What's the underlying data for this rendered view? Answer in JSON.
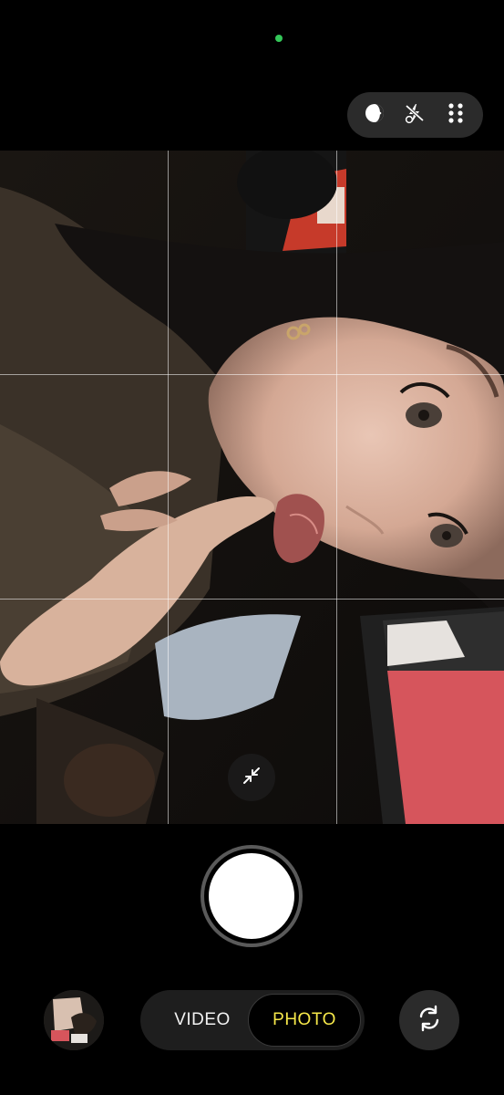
{
  "status": {
    "privacy_indicator_color": "#34c759"
  },
  "quick_settings": {
    "items": [
      {
        "icon": "filter-icon"
      },
      {
        "icon": "flash-off-icon"
      },
      {
        "icon": "more-options-icon"
      }
    ]
  },
  "viewfinder": {
    "grid_lines": "3x3",
    "overlay_button_icon": "collapse-arrows-icon"
  },
  "shutter": {
    "icon": "shutter-button"
  },
  "bottom_bar": {
    "gallery_icon": "gallery-thumbnail",
    "modes": {
      "video_label": "VIDEO",
      "photo_label": "PHOTO",
      "selected": "PHOTO"
    },
    "selected_color": "#f6e84a",
    "switch_camera_icon": "switch-camera-icon"
  }
}
